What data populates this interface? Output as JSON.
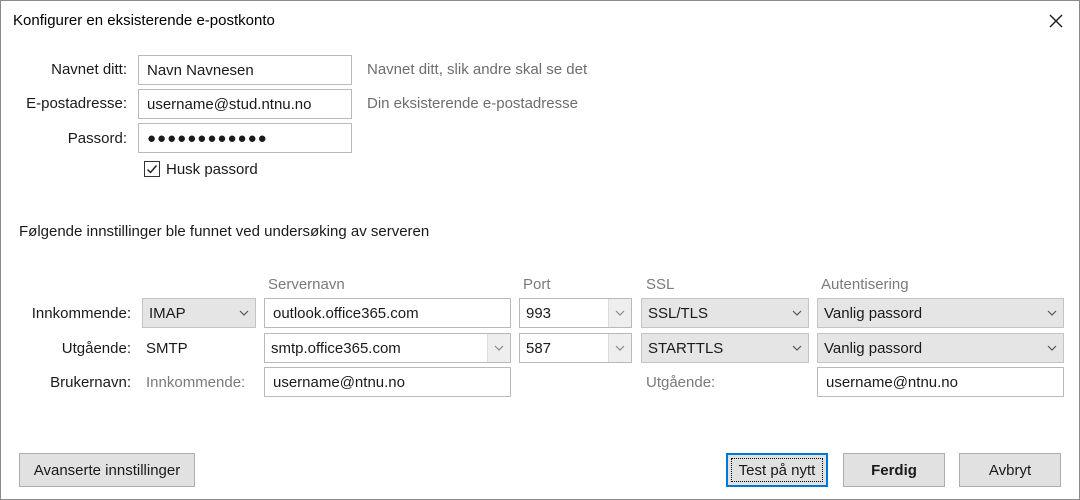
{
  "window": {
    "title": "Konfigurer en eksisterende e-postkonto"
  },
  "account": {
    "name_label": "Navnet ditt:",
    "name_value": "Navn Navnesen",
    "name_hint": "Navnet ditt, slik andre skal se det",
    "email_label": "E-postadresse:",
    "email_value": "username@stud.ntnu.no",
    "email_hint": "Din eksisterende e-postadresse",
    "password_label": "Passord:",
    "password_value": "●●●●●●●●●●●●",
    "remember_label": "Husk passord",
    "remember_checked": true
  },
  "found_message": "Følgende innstillinger ble funnet ved undersøking av serveren",
  "columns": {
    "server": "Servernavn",
    "port": "Port",
    "ssl": "SSL",
    "auth": "Autentisering"
  },
  "incoming": {
    "label": "Innkommende:",
    "protocol": "IMAP",
    "server": "outlook.office365.com",
    "port": "993",
    "ssl": "SSL/TLS",
    "auth": "Vanlig passord"
  },
  "outgoing": {
    "label": "Utgående:",
    "protocol": "SMTP",
    "server": "smtp.office365.com",
    "port": "587",
    "ssl": "STARTTLS",
    "auth": "Vanlig passord"
  },
  "username": {
    "label": "Brukernavn:",
    "incoming_label": "Innkommende:",
    "incoming_value": "username@ntnu.no",
    "outgoing_label": "Utgående:",
    "outgoing_value": "username@ntnu.no"
  },
  "buttons": {
    "advanced": "Avanserte innstillinger",
    "retest": "Test på nytt",
    "done": "Ferdig",
    "cancel": "Avbryt"
  },
  "colors": {
    "focus_border": "#0078d7",
    "button_bg": "#e1e1e1",
    "select_bg": "#e5e5e5"
  }
}
